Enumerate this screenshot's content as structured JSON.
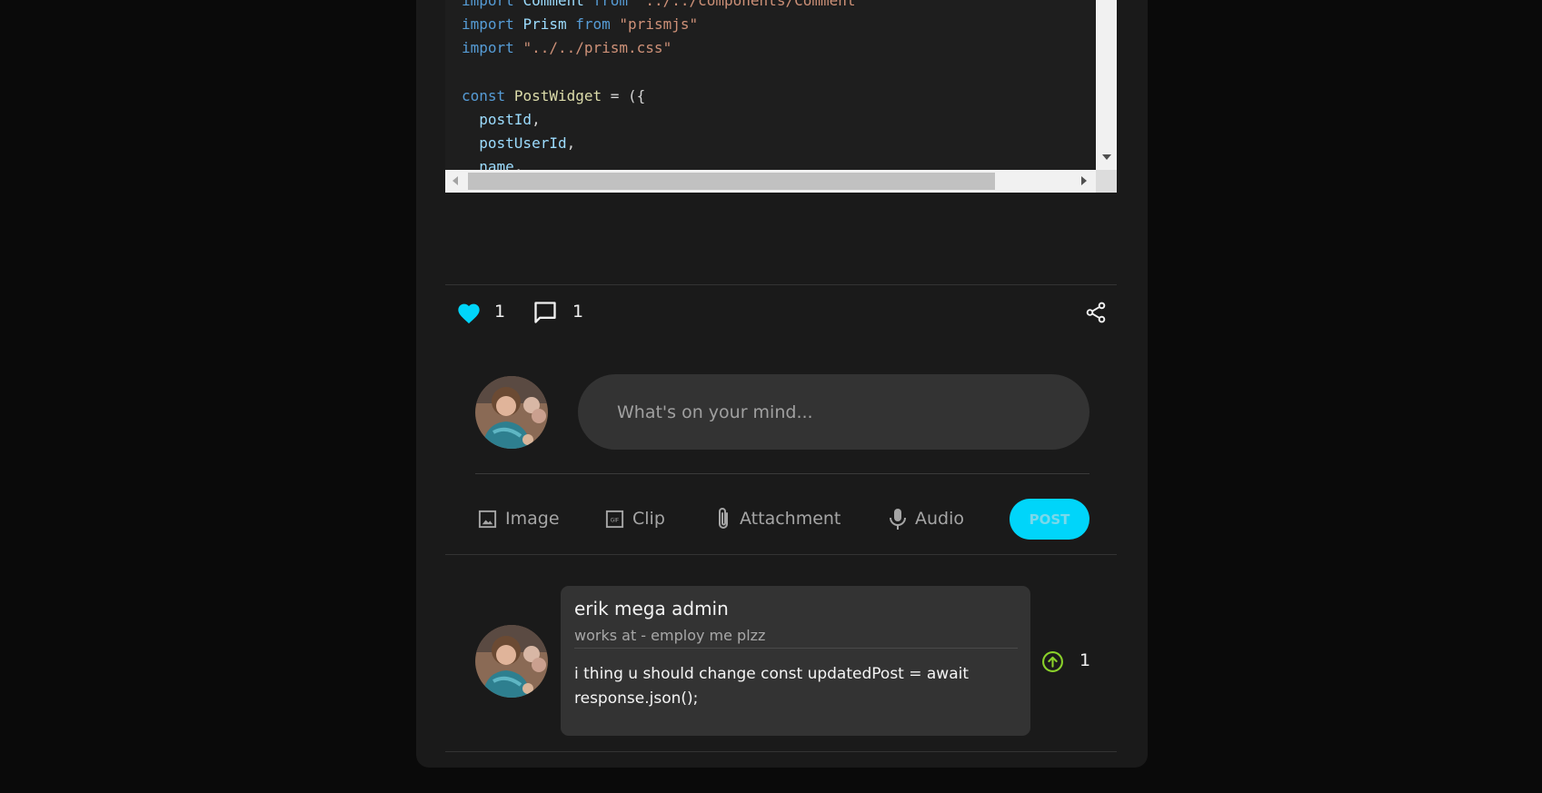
{
  "code": {
    "lines": [
      [
        {
          "t": "import",
          "c": "kw"
        },
        {
          "t": " "
        },
        {
          "t": "Comment",
          "c": "id"
        },
        {
          "t": " "
        },
        {
          "t": "from",
          "c": "kw"
        },
        {
          "t": " "
        },
        {
          "t": "\"../../components/Comment\"",
          "c": "str"
        }
      ],
      [
        {
          "t": "import",
          "c": "kw"
        },
        {
          "t": " "
        },
        {
          "t": "Prism",
          "c": "id"
        },
        {
          "t": " "
        },
        {
          "t": "from",
          "c": "kw"
        },
        {
          "t": " "
        },
        {
          "t": "\"prismjs\"",
          "c": "str"
        }
      ],
      [
        {
          "t": "import",
          "c": "kw"
        },
        {
          "t": " "
        },
        {
          "t": "\"../../prism.css\"",
          "c": "str"
        }
      ],
      [
        {
          "t": ""
        }
      ],
      [
        {
          "t": "const",
          "c": "kw"
        },
        {
          "t": " "
        },
        {
          "t": "PostWidget",
          "c": "fn"
        },
        {
          "t": " = ({"
        }
      ],
      [
        {
          "t": "  "
        },
        {
          "t": "postId",
          "c": "id"
        },
        {
          "t": ","
        }
      ],
      [
        {
          "t": "  "
        },
        {
          "t": "postUserId",
          "c": "id"
        },
        {
          "t": ","
        }
      ],
      [
        {
          "t": "  "
        },
        {
          "t": "name",
          "c": "id"
        },
        {
          "t": ","
        }
      ]
    ]
  },
  "stats": {
    "likes": "1",
    "comments": "1"
  },
  "composer": {
    "placeholder": "What's on your mind...",
    "actions": {
      "image": "Image",
      "clip": "Clip",
      "attachment": "Attachment",
      "audio": "Audio"
    },
    "post_label": "POST"
  },
  "comment": {
    "author": "erik mega admin",
    "subtitle": "works at - employ me plzz",
    "text": "i thing u should change const updatedPost = await response.json();",
    "votes": "1"
  },
  "colors": {
    "accent": "#00d5fa",
    "upvote": "#8ad12a"
  }
}
